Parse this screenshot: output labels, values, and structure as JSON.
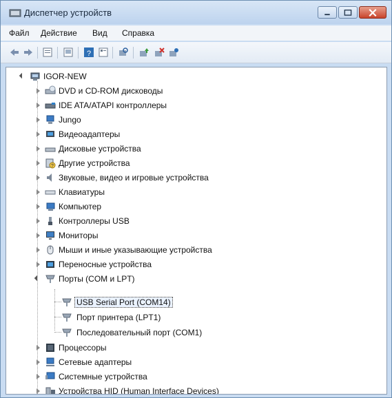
{
  "window": {
    "title": "Диспетчер устройств",
    "controls": {
      "minimize_icon": "minimize-icon",
      "maximize_icon": "maximize-icon",
      "close_icon": "close-icon"
    }
  },
  "menu": [
    "Файл",
    "Действие",
    "Вид",
    "Справка"
  ],
  "toolbar": {
    "icons": [
      "back-arrow-icon",
      "forward-arrow-icon",
      "properties-view-icon",
      "show-hide-icon",
      "help-icon",
      "details-icon",
      "scan-hardware-icon",
      "update-driver-icon",
      "disable-device-icon",
      "uninstall-device-icon"
    ]
  },
  "tree": {
    "root": {
      "label": "IGOR-NEW",
      "icon": "computer-icon"
    },
    "items": [
      {
        "label": "DVD и CD-ROM дисководы",
        "icon": "dvd-drive-icon"
      },
      {
        "label": "IDE ATA/ATAPI контроллеры",
        "icon": "ide-controller-icon"
      },
      {
        "label": "Jungo",
        "icon": "device-icon"
      },
      {
        "label": "Видеоадаптеры",
        "icon": "display-adapter-icon"
      },
      {
        "label": "Дисковые устройства",
        "icon": "disk-drive-icon"
      },
      {
        "label": "Другие устройства",
        "icon": "unknown-device-icon"
      },
      {
        "label": "Звуковые, видео и игровые устройства",
        "icon": "sound-icon"
      },
      {
        "label": "Клавиатуры",
        "icon": "keyboard-icon"
      },
      {
        "label": "Компьютер",
        "icon": "computer-small-icon"
      },
      {
        "label": "Контроллеры USB",
        "icon": "usb-icon"
      },
      {
        "label": "Мониторы",
        "icon": "monitor-icon"
      },
      {
        "label": "Мыши и иные указывающие устройства",
        "icon": "mouse-icon"
      },
      {
        "label": "Переносные устройства",
        "icon": "portable-device-icon"
      },
      {
        "label": "Порты (COM и LPT)",
        "icon": "port-icon",
        "expanded": true,
        "children": [
          {
            "label": "USB Serial Port (COM14)",
            "icon": "port-icon",
            "selected": true
          },
          {
            "label": "Порт принтера (LPT1)",
            "icon": "port-icon"
          },
          {
            "label": "Последовательный порт (COM1)",
            "icon": "port-icon"
          }
        ]
      },
      {
        "label": "Процессоры",
        "icon": "processor-icon"
      },
      {
        "label": "Сетевые адаптеры",
        "icon": "network-adapter-icon"
      },
      {
        "label": "Системные устройства",
        "icon": "system-device-icon"
      },
      {
        "label": "Устройства HID (Human Interface Devices)",
        "icon": "hid-icon"
      }
    ]
  },
  "colors": {
    "titlebar": "#c9dcf2",
    "close": "#c8442c",
    "selection": "#eaf2ff"
  }
}
